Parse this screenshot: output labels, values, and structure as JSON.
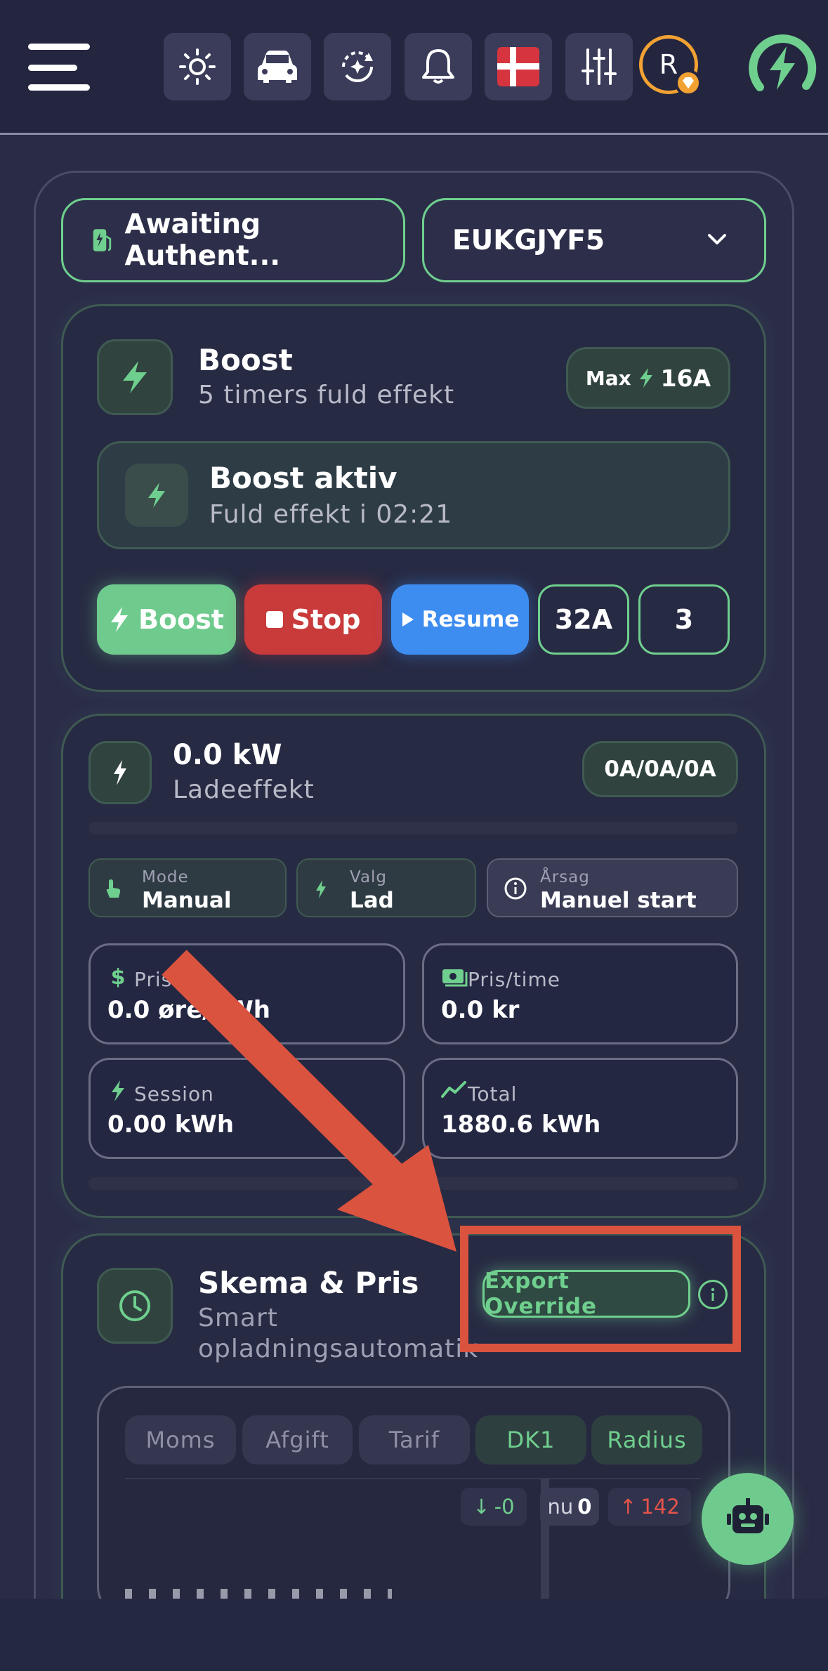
{
  "header": {
    "avatar_letter": "R",
    "icons": [
      "menu-icon",
      "sun-icon",
      "car-icon",
      "refresh-sparkle-icon",
      "bell-icon",
      "denmark-flag-icon",
      "sliders-icon",
      "brand-logo-icon"
    ]
  },
  "status": {
    "charger_state": "Awaiting Authent...",
    "charger_id": "EUKGJYF5"
  },
  "boost": {
    "title": "Boost",
    "subtitle": "5 timers fuld effekt",
    "max_label": "Max",
    "max_value": "16A",
    "active_title": "Boost aktiv",
    "active_subtitle": "Fuld effekt i 02:21",
    "buttons": {
      "boost": "Boost",
      "stop": "Stop",
      "resume": "Resume",
      "current": "32A",
      "phases": "3"
    }
  },
  "power": {
    "value": "0.0 kW",
    "label": "Ladeeffekt",
    "phases": "0A/0A/0A",
    "chips": [
      {
        "label": "Mode",
        "value": "Manual"
      },
      {
        "label": "Valg",
        "value": "Lad"
      },
      {
        "label": "Årsag",
        "value": "Manuel start"
      }
    ],
    "stats": [
      {
        "label": "Pris",
        "value": "0.0 øre/kWh"
      },
      {
        "label": "Pris/time",
        "value": "0.0 kr"
      },
      {
        "label": "Session",
        "value": "0.00 kWh"
      },
      {
        "label": "Total",
        "value": "1880.6 kWh"
      }
    ]
  },
  "schedule": {
    "title": "Skema & Pris",
    "subtitle_line1": "Smart",
    "subtitle_line2": "opladningsautomatik",
    "export_override": "Export Override",
    "tabs": [
      "Moms",
      "Afgift",
      "Tarif",
      "DK1",
      "Radius"
    ],
    "badges": {
      "down_arrow": "↓",
      "down": "-0",
      "now_label": "nu",
      "now": "0",
      "up_arrow": "↑",
      "up": "142"
    }
  },
  "colors": {
    "accent_green": "#6fcf8e",
    "stop_red": "#c93a3a",
    "resume_blue": "#3d8cf0",
    "annotation_red": "#d9533f",
    "gold": "#f2a232"
  }
}
